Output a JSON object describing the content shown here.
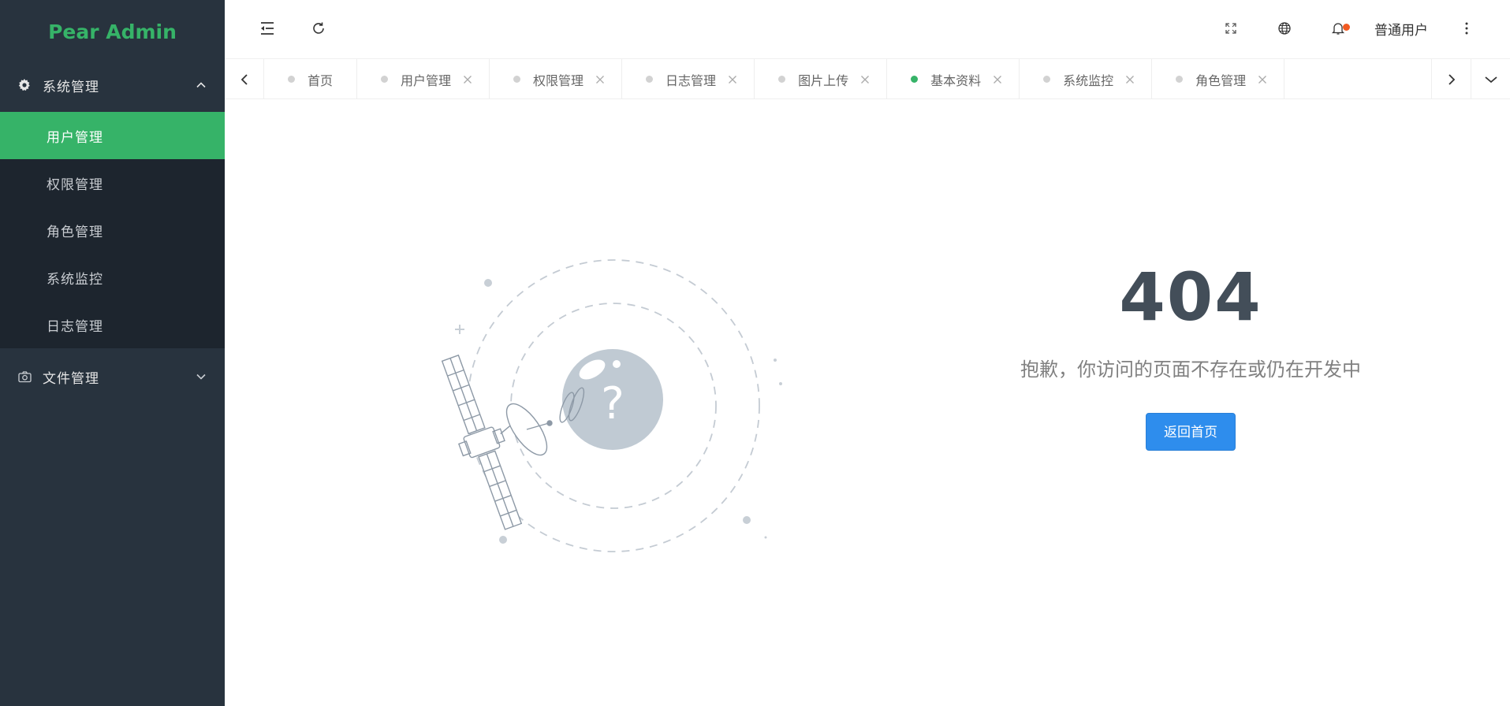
{
  "sidebar": {
    "logo": "Pear Admin",
    "groups": [
      {
        "label": "系统管理",
        "icon": "gear-icon",
        "expanded": true,
        "items": [
          {
            "label": "用户管理",
            "active": true
          },
          {
            "label": "权限管理",
            "active": false
          },
          {
            "label": "角色管理",
            "active": false
          },
          {
            "label": "系统监控",
            "active": false
          },
          {
            "label": "日志管理",
            "active": false
          }
        ]
      },
      {
        "label": "文件管理",
        "icon": "camera-icon",
        "expanded": false,
        "items": []
      }
    ]
  },
  "header": {
    "user_name": "普通用户",
    "notification_badge_color": "#f15a22"
  },
  "tabs": [
    {
      "label": "首页",
      "closable": false,
      "active": false
    },
    {
      "label": "用户管理",
      "closable": true,
      "active": false
    },
    {
      "label": "权限管理",
      "closable": true,
      "active": false
    },
    {
      "label": "日志管理",
      "closable": true,
      "active": false
    },
    {
      "label": "图片上传",
      "closable": true,
      "active": false
    },
    {
      "label": "基本资料",
      "closable": true,
      "active": true
    },
    {
      "label": "系统监控",
      "closable": true,
      "active": false
    },
    {
      "label": "角色管理",
      "closable": true,
      "active": false
    }
  ],
  "error_page": {
    "code": "404",
    "message": "抱歉，你访问的页面不存在或仍在开发中",
    "button_label": "返回首页"
  },
  "colors": {
    "brand": "#36b368",
    "sidebar_bg": "#28333e",
    "submenu_bg": "#1d252e",
    "button_primary": "#2e8ded",
    "error_code": "#434e59"
  }
}
